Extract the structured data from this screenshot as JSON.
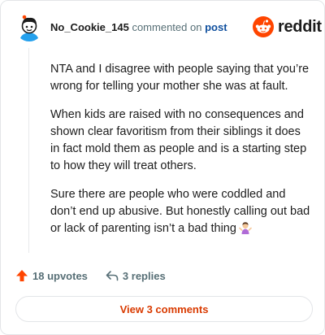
{
  "comment": {
    "username": "No_Cookie_145",
    "action_text": "commented on",
    "post_link": "post",
    "paragraphs": [
      "NTA and I disagree with people saying that you’re wrong for telling your mother she was at fault.",
      "When kids are raised with no consequences and shown clear favoritism from their siblings it does in fact mold them as people and is a starting step to how they will treat others.",
      "Sure there are people who were coddled and don’t end up abusive. But honestly calling out bad or lack of parenting isn’t a bad thing"
    ]
  },
  "brand": {
    "name": "reddit",
    "color": "#ff4500"
  },
  "actions": {
    "upvotes": "18 upvotes",
    "replies": "3 replies"
  },
  "view_button": {
    "label": "View 3 comments",
    "color": "#d93a00"
  },
  "icons": {
    "avatar": "snoo-avatar-icon",
    "logo": "reddit-alien-icon",
    "upvote": "upvote-arrow-icon",
    "reply": "reply-arrow-icon",
    "emoji": "person-shrugging-emoji-icon"
  }
}
